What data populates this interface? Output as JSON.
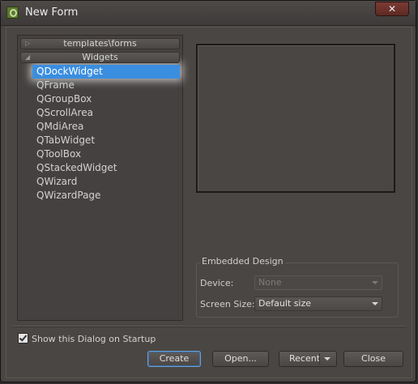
{
  "window": {
    "title": "New Form",
    "close_symbol": "✕"
  },
  "tree": {
    "categories": [
      {
        "label": "templates\\forms",
        "expanded": false,
        "arrow": "▷"
      },
      {
        "label": "Widgets",
        "expanded": true,
        "arrow": "◢"
      }
    ],
    "items": [
      {
        "label": "QDockWidget",
        "selected": true
      },
      {
        "label": "QFrame"
      },
      {
        "label": "QGroupBox"
      },
      {
        "label": "QScrollArea"
      },
      {
        "label": "QMdiArea"
      },
      {
        "label": "QTabWidget"
      },
      {
        "label": "QToolBox"
      },
      {
        "label": "QStackedWidget"
      },
      {
        "label": "QWizard"
      },
      {
        "label": "QWizardPage"
      }
    ]
  },
  "embedded": {
    "title": "Embedded Design",
    "device_label": "Device:",
    "device_value": "None",
    "screen_size_label": "Screen Size:",
    "screen_size_value": "Default size"
  },
  "startup": {
    "label": "Show this Dialog on Startup",
    "checked": true
  },
  "buttons": {
    "create": "Create",
    "open": "Open...",
    "recent": "Recent",
    "close": "Close"
  },
  "colors": {
    "selection": "#3a8ee0",
    "background": "#4a4644"
  }
}
